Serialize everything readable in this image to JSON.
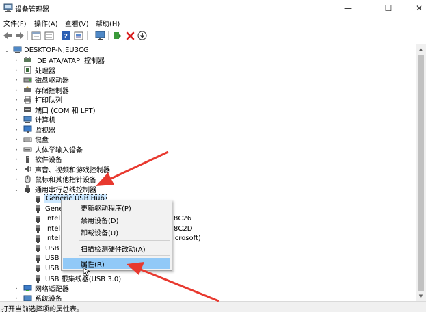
{
  "window": {
    "title": "设备管理器",
    "minimize": "—",
    "maximize": "☐",
    "close": "✕"
  },
  "menu": {
    "file": "文件(F)",
    "action": "操作(A)",
    "view": "查看(V)",
    "help": "帮助(H)"
  },
  "toolbar": {
    "icons": [
      "back-icon",
      "forward-icon",
      "properties-icon",
      "list-icon",
      "help-icon",
      "view-icon",
      "monitor-icon",
      "update-driver-icon",
      "uninstall-icon",
      "download-icon"
    ]
  },
  "tree": {
    "root": "DESKTOP-NJEU3CG",
    "categories": [
      "IDE ATA/ATAPI 控制器",
      "处理器",
      "磁盘驱动器",
      "存储控制器",
      "打印队列",
      "端口 (COM 和 LPT)",
      "计算机",
      "监视器",
      "键盘",
      "人体学输入设备",
      "软件设备",
      "声音、视频和游戏控制器",
      "鼠标和其他指针设备",
      "通用串行总线控制器"
    ],
    "usb_children": [
      "Generic USB Hub",
      "Gene",
      "Intel(",
      "Intel(",
      "Intel(",
      "USB (",
      "USB I",
      "USB I",
      "USB 根集线器(USB 3.0)"
    ],
    "usb_child_suffixes": [
      "8C26",
      "8C2D",
      "icrosoft)"
    ],
    "after_categories": [
      "网络适配器",
      "系统设备"
    ]
  },
  "context_menu": {
    "update_driver": "更新驱动程序(P)",
    "disable_device": "禁用设备(D)",
    "uninstall_device": "卸载设备(U)",
    "scan_hardware": "扫描检测硬件改动(A)",
    "properties": "属性(R)"
  },
  "status": {
    "text": "打开当前选择项的属性表。"
  },
  "colors": {
    "highlight": "#91c9f7",
    "selection": "#cce8ff",
    "arrow": "#e8392f"
  }
}
